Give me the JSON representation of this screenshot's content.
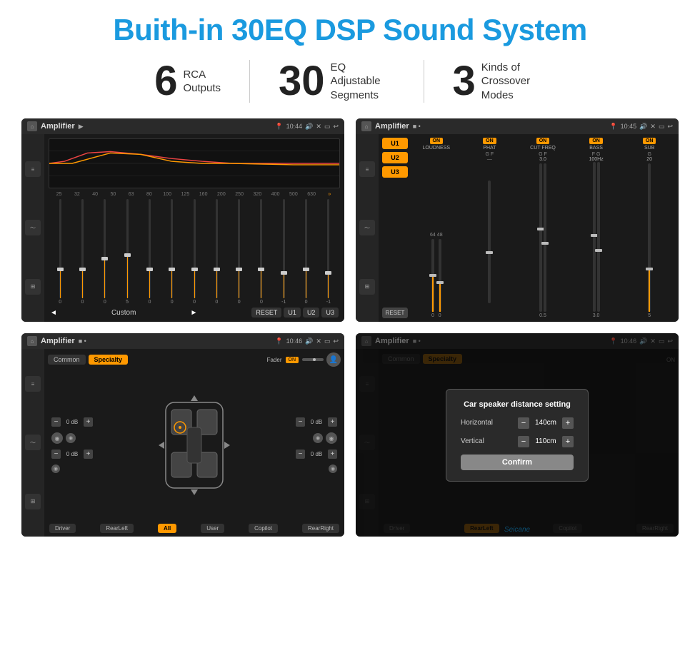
{
  "title": "Buith-in 30EQ DSP Sound System",
  "stats": [
    {
      "number": "6",
      "label": "RCA\nOutputs"
    },
    {
      "number": "30",
      "label": "EQ Adjustable\nSegments"
    },
    {
      "number": "3",
      "label": "Kinds of\nCrossover Modes"
    }
  ],
  "screens": {
    "eq": {
      "statusBar": {
        "title": "Amplifier",
        "time": "10:44"
      },
      "freqLabels": [
        "25",
        "32",
        "40",
        "50",
        "63",
        "80",
        "100",
        "125",
        "160",
        "200",
        "250",
        "320",
        "400",
        "500",
        "630"
      ],
      "sliderValues": [
        "0",
        "0",
        "0",
        "5",
        "0",
        "0",
        "0",
        "0",
        "0",
        "0",
        "-1",
        "0",
        "-1"
      ],
      "presets": [
        "Custom",
        "RESET",
        "U1",
        "U2",
        "U3"
      ]
    },
    "amplifier": {
      "statusBar": {
        "title": "Amplifier",
        "time": "10:45"
      },
      "channels": [
        "LOUDNESS",
        "PHAT",
        "CUT FREQ",
        "BASS",
        "SUB"
      ],
      "uButtons": [
        "U1",
        "U2",
        "U3"
      ],
      "resetLabel": "RESET"
    },
    "fader": {
      "statusBar": {
        "title": "Amplifier",
        "time": "10:46"
      },
      "tabs": [
        "Common",
        "Specialty"
      ],
      "activeTab": "Specialty",
      "faderLabel": "Fader",
      "faderOnLabel": "ON",
      "channelLabels": [
        "0 dB",
        "0 dB",
        "0 dB",
        "0 dB"
      ],
      "bottomBtns": [
        "Driver",
        "RearLeft",
        "All",
        "User",
        "Copilot",
        "RearRight"
      ]
    },
    "dialog": {
      "statusBar": {
        "title": "Amplifier",
        "time": "10:46"
      },
      "dialogTitle": "Car speaker distance setting",
      "fields": [
        {
          "label": "Horizontal",
          "value": "140cm"
        },
        {
          "label": "Vertical",
          "value": "110cm"
        }
      ],
      "confirmLabel": "Confirm",
      "bottomBtns": [
        "Driver",
        "RearLeft",
        "Copilot",
        "RearRight"
      ]
    }
  },
  "watermark": "Seicane"
}
